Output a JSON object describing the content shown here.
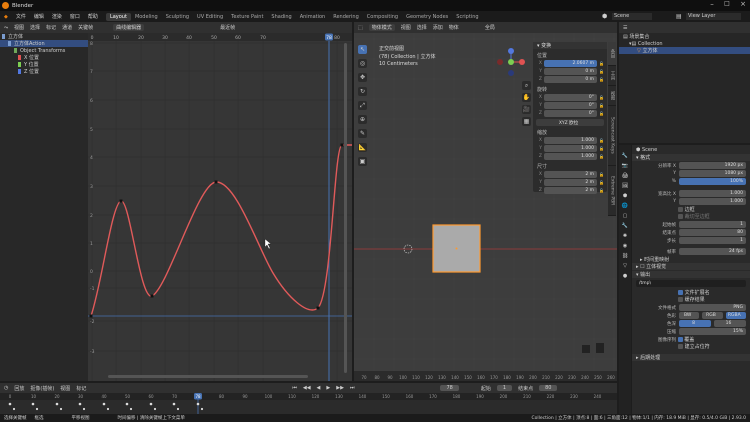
{
  "app": {
    "title": "Blender"
  },
  "menu": [
    "文件",
    "编辑",
    "渲染",
    "窗口",
    "帮助"
  ],
  "workspaces": [
    "Layout",
    "Modeling",
    "Sculpting",
    "UV Editing",
    "Texture Paint",
    "Shading",
    "Animation",
    "Rendering",
    "Compositing",
    "Geometry Nodes",
    "Scripting"
  ],
  "scene": {
    "label": "Scene",
    "view_layer": "View Layer"
  },
  "graph": {
    "header": [
      "视图",
      "选择",
      "标记",
      "通道",
      "关键帧"
    ],
    "mode": "曲线编辑器",
    "pivot": "最近帧",
    "top_ticks": [
      "0",
      "10",
      "20",
      "30",
      "40",
      "50",
      "60",
      "70",
      "78",
      "80"
    ],
    "side_ticks": [
      "8",
      "7",
      "6",
      "5",
      "4",
      "3",
      "2",
      "1",
      "0",
      "-1",
      "-2",
      "-3"
    ],
    "channels": [
      {
        "name": "立方体",
        "color": "#7a9ccf"
      },
      {
        "name": "立方体Action",
        "color": "#7a9ccf"
      },
      {
        "name": "Object Transforms",
        "color": "#6fa85a"
      },
      {
        "name": "X 位置",
        "color": "#e05252"
      },
      {
        "name": "Y 位置",
        "color": "#7ccf52"
      },
      {
        "name": "Z 位置",
        "color": "#5278e0"
      }
    ],
    "curve_color": "#e05a5a",
    "current_frame": "78"
  },
  "viewport": {
    "header": [
      "物体模式",
      "视图",
      "选择",
      "添加",
      "物体"
    ],
    "global": "全局",
    "title": "正交前视图",
    "subtitle": "(78) Collection | 立方体",
    "scale": "10 Centimeters",
    "ruler": [
      "70",
      "80",
      "90",
      "100",
      "110",
      "120",
      "130",
      "140",
      "150",
      "160",
      "170",
      "180",
      "190",
      "200",
      "210",
      "220",
      "230",
      "240",
      "250",
      "260"
    ]
  },
  "n_panel": {
    "section": "变换",
    "location_label": "位置",
    "location": {
      "x": "2.0607 m",
      "y": "0 m",
      "z": "0 m"
    },
    "rotation_label": "旋转",
    "rotation": {
      "x": "0°",
      "y": "0°",
      "z": "0°"
    },
    "rot_mode": "XYZ 欧拉",
    "scale_label": "缩放",
    "scale": {
      "x": "1.000",
      "y": "1.000",
      "z": "1.000"
    },
    "dims_label": "尺寸",
    "dims": {
      "x": "2 m",
      "y": "2 m",
      "z": "2 m"
    },
    "tabs": [
      "条目",
      "工具",
      "视图",
      "Screencast Keys",
      "Extreme PBR"
    ]
  },
  "outliner": {
    "root": "场景集合",
    "collection": "Collection",
    "object": "立方体"
  },
  "properties": {
    "scene": "Scene",
    "format_section": "格式",
    "res_x_label": "分辨率 X",
    "res_x": "1920 px",
    "res_y_label": "Y",
    "res_y": "1080 px",
    "pct_label": "%",
    "pct": "100%",
    "aspect_x_label": "宽高比 X",
    "aspect_x": "1.000",
    "aspect_y_label": "Y",
    "aspect_y": "1.000",
    "border_label": "边框",
    "crop_label": "裁切至边框",
    "frame_start_label": "起始帧",
    "frame_start": "1",
    "frame_end_label": "结束点",
    "frame_end": "80",
    "step_label": "步长",
    "step": "1",
    "fps_label": "帧率",
    "fps": "24 fps",
    "time_remap": "时间重映射",
    "stereo": "立体视觉",
    "output_section": "输出",
    "path": "/tmp\\",
    "overwrite": "文件扩展名",
    "cache": "缓存结果",
    "file_format_label": "文件格式",
    "file_format": "PNG",
    "color_label": "色彩",
    "color_opts": [
      "BW",
      "RGB",
      "RGBA"
    ],
    "depth_label": "色深",
    "depth_opts": [
      "8",
      "16"
    ],
    "compress_label": "压缩",
    "compress": "15%",
    "image_seq_label": "图像序列",
    "overwrite_label": "覆盖",
    "placeholder_label": "建立占位符",
    "post_label": "后期处理"
  },
  "timeline": {
    "menu": [
      "回放",
      "抠像(插帧)",
      "视图",
      "标记"
    ],
    "current": "78",
    "start_label": "起始",
    "start": "1",
    "end_label": "结束点",
    "end": "80",
    "ticks": [
      "0",
      "10",
      "20",
      "30",
      "40",
      "50",
      "60",
      "70",
      "78",
      "80",
      "90",
      "100",
      "110",
      "120",
      "130",
      "140",
      "150",
      "160",
      "170",
      "180",
      "190",
      "200",
      "210",
      "220",
      "230",
      "240",
      "250"
    ]
  },
  "status": {
    "left1": "选择关键帧",
    "left2": "框选",
    "left3": "平移视图",
    "left4": "时间偏移 | 清除关键帧上下文菜单",
    "right": "Collection | 立方体 | 顶点:8 | 面:6 | 三角面:12 | 物体:1/1 | 内存: 18.9 MiB | 显存: 0.5/4.0 GiB | 2.93.0"
  }
}
